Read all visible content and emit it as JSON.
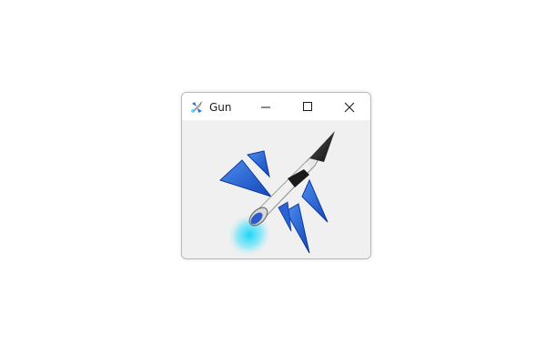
{
  "window": {
    "title": "Gun",
    "app_icon": "rocket-icon",
    "controls": {
      "minimize_icon": "minimize-icon",
      "maximize_icon": "maximize-icon",
      "close_icon": "close-icon"
    }
  },
  "content": {
    "image": "rocket-image"
  },
  "colors": {
    "titlebar": "#ffffff",
    "client_background": "#f0f0f0",
    "rocket_wing": "#1f63d6",
    "rocket_flame": "#1ad0f0"
  }
}
